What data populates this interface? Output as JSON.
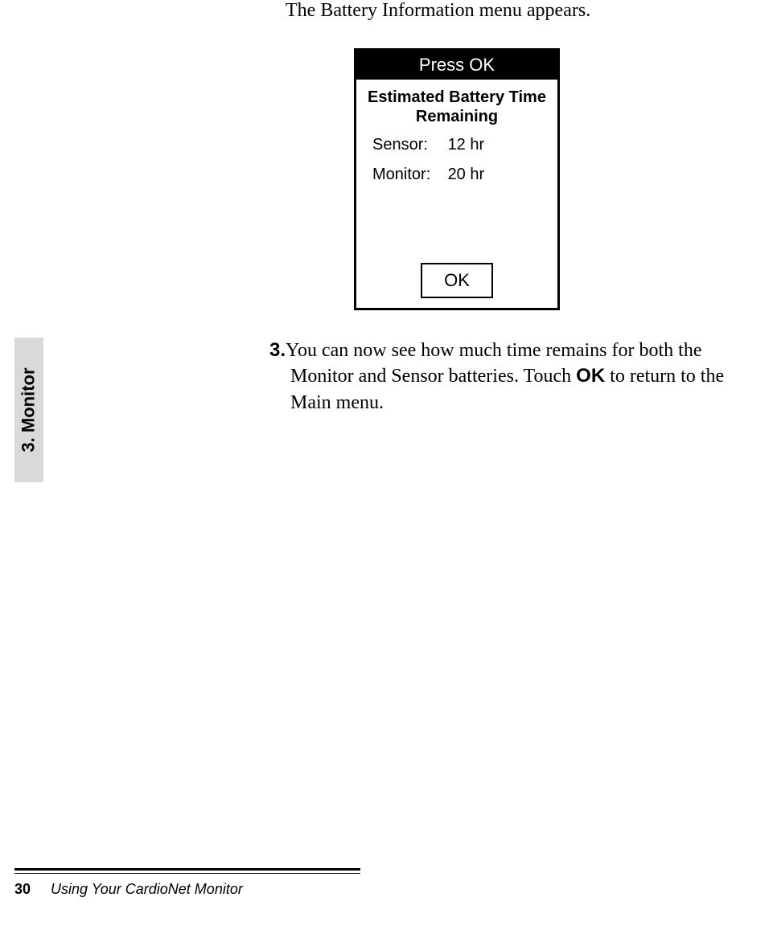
{
  "intro": "The Battery Information menu appears.",
  "device": {
    "titlebar": "Press OK",
    "heading": "Estimated Battery Time Remaining",
    "rows": [
      {
        "label": "Sensor:",
        "value": "12 hr"
      },
      {
        "label": "Monitor:",
        "value": "20 hr"
      }
    ],
    "ok": "OK"
  },
  "side_tab": "3. Monitor",
  "step": {
    "number": "3",
    "dot": ".",
    "text_before_ok": "You can now see how much time remains for both the Monitor and Sensor batteries.  Touch ",
    "ok_bold": "OK",
    "text_after_ok": " to return to the Main menu."
  },
  "footer": {
    "page_number": "30",
    "title": "Using Your CardioNet Monitor"
  }
}
